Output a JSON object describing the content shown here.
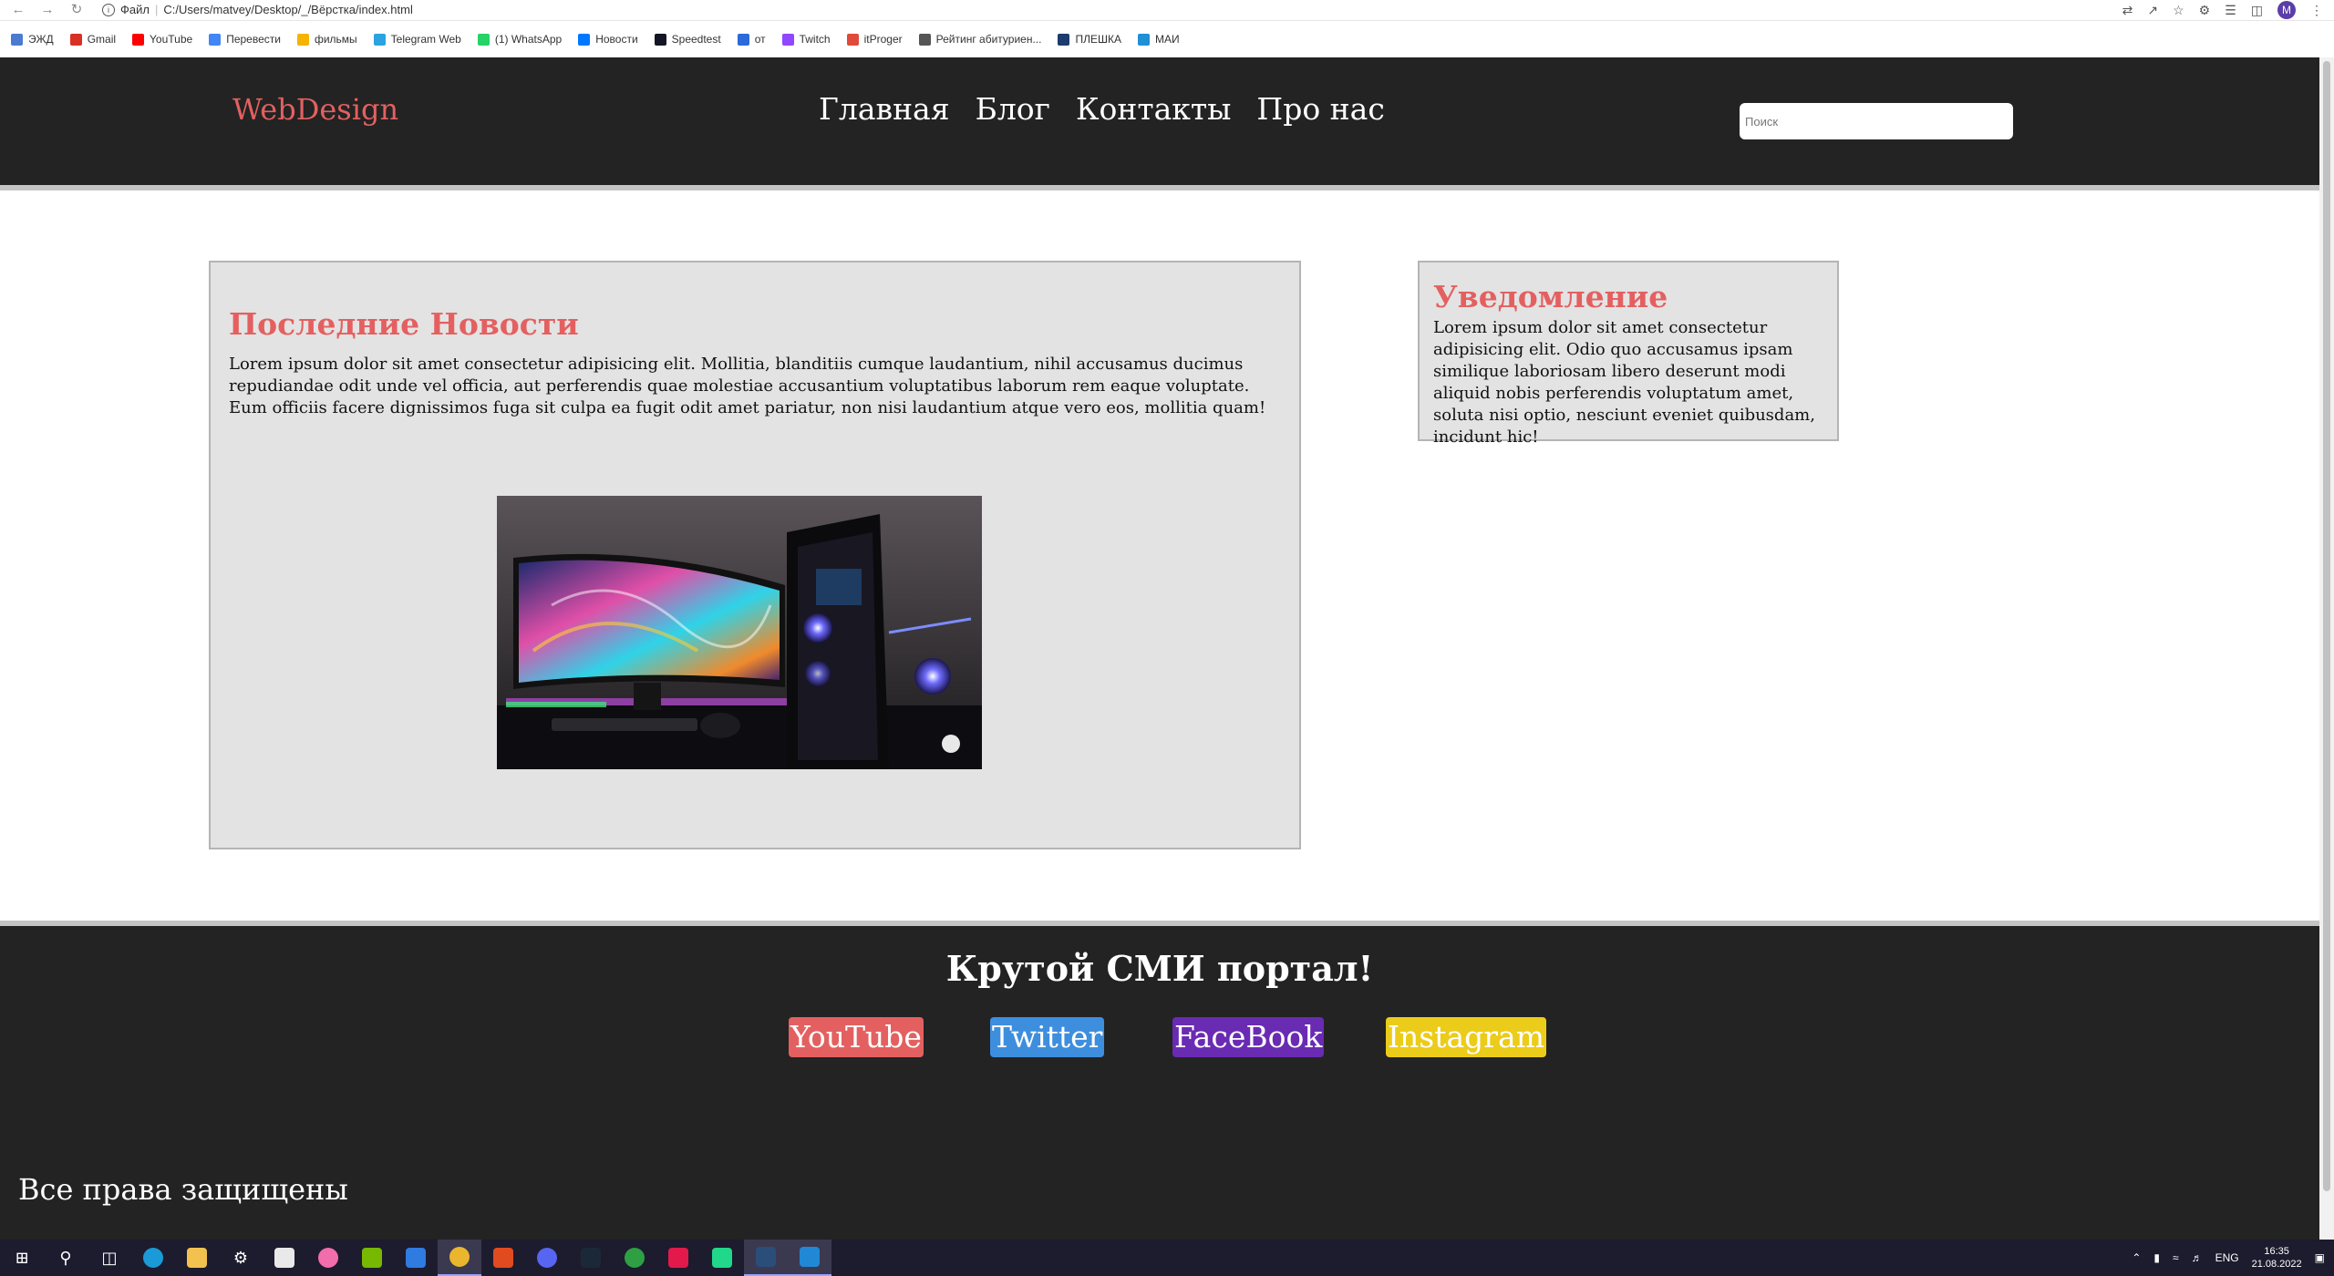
{
  "browser": {
    "address_label": "Файл",
    "address_url": "C:/Users/matvey/Desktop/_/Вёрстка/index.html",
    "avatar_letter": "M",
    "bookmarks": [
      {
        "label": "ЭЖД",
        "color": "#4a7bd0"
      },
      {
        "label": "Gmail",
        "color": "#d93025"
      },
      {
        "label": "YouTube",
        "color": "#ff0000"
      },
      {
        "label": "Перевести",
        "color": "#4285f4"
      },
      {
        "label": "фильмы",
        "color": "#f5b400"
      },
      {
        "label": "Telegram Web",
        "color": "#2aa3e0"
      },
      {
        "label": "(1) WhatsApp",
        "color": "#25d366"
      },
      {
        "label": "Новости",
        "color": "#0077ff"
      },
      {
        "label": "Speedtest",
        "color": "#141526"
      },
      {
        "label": "от",
        "color": "#2b6ad9"
      },
      {
        "label": "Twitch",
        "color": "#9146ff"
      },
      {
        "label": "itProger",
        "color": "#e04a3a"
      },
      {
        "label": "Рейтинг абитуриен...",
        "color": "#555555"
      },
      {
        "label": "ПЛЕШКА",
        "color": "#1c3b6e"
      },
      {
        "label": "МАИ",
        "color": "#1f8fd6"
      }
    ]
  },
  "header": {
    "logo": "WebDesign",
    "nav": [
      "Главная",
      "Блог",
      "Контакты",
      "Про нас"
    ],
    "search_placeholder": "Поиск"
  },
  "news": {
    "title": "Последние Новости",
    "text": "Lorem ipsum dolor sit amet consectetur adipisicing elit. Mollitia, blanditiis cumque laudantium, nihil accusamus ducimus repudiandae odit unde vel officia, aut perferendis quae molestiae accusantium voluptatibus laborum rem eaque voluptate. Eum officiis facere dignissimos fuga sit culpa ea fugit odit amet pariatur, non nisi laudantium atque vero eos, mollitia quam!"
  },
  "notice": {
    "title": "Уведомление",
    "text": "Lorem ipsum dolor sit amet consectetur adipisicing elit. Odio quo accusamus ipsam similique laboriosam libero deserunt modi aliquid nobis perferendis voluptatum amet, soluta nisi optio, nesciunt eveniet quibusdam, incidunt hic!"
  },
  "footer": {
    "title": "Крутой СМИ портал!",
    "social": [
      {
        "label": "YouTube",
        "color": "#e46060"
      },
      {
        "label": "Twitter",
        "color": "#3e8ede"
      },
      {
        "label": "FaceBook",
        "color": "#6a2bb3"
      },
      {
        "label": "Instagram",
        "color": "#eccc1a"
      }
    ],
    "copyright": "Все права защищены"
  },
  "taskbar": {
    "lang": "ENG",
    "time": "16:35",
    "date": "21.08.2022"
  }
}
